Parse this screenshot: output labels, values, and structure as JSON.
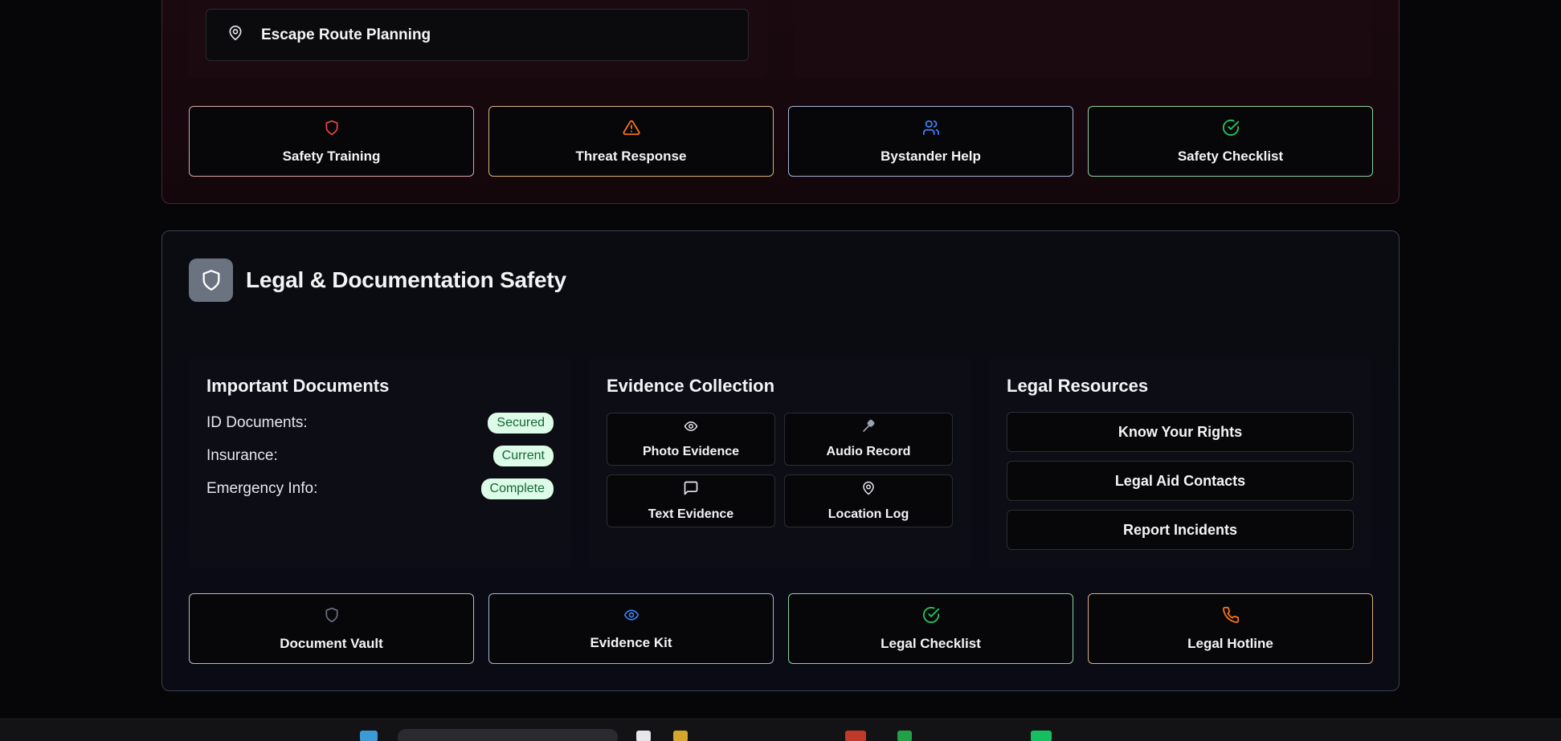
{
  "top_section": {
    "escape_label": "Escape Route Planning",
    "actions": [
      {
        "label": "Safety Training",
        "icon": "shield-icon",
        "color": "#ef4444"
      },
      {
        "label": "Threat Response",
        "icon": "warning-triangle-icon",
        "color": "#f97316"
      },
      {
        "label": "Bystander Help",
        "icon": "users-icon",
        "color": "#3b82f6"
      },
      {
        "label": "Safety Checklist",
        "icon": "check-circle-icon",
        "color": "#22c55e"
      }
    ]
  },
  "legal": {
    "title": "Legal & Documentation Safety",
    "icon": "shield-icon",
    "documents": {
      "title": "Important Documents",
      "rows": [
        {
          "label": "ID Documents:",
          "status": "Secured"
        },
        {
          "label": "Insurance:",
          "status": "Current"
        },
        {
          "label": "Emergency Info:",
          "status": "Complete"
        }
      ]
    },
    "evidence": {
      "title": "Evidence Collection",
      "items": [
        {
          "label": "Photo Evidence",
          "icon": "eye-icon"
        },
        {
          "label": "Audio Record",
          "icon": "microphone-icon"
        },
        {
          "label": "Text Evidence",
          "icon": "message-icon"
        },
        {
          "label": "Location Log",
          "icon": "map-pin-icon"
        }
      ]
    },
    "resources": {
      "title": "Legal Resources",
      "items": [
        "Know Your Rights",
        "Legal Aid Contacts",
        "Report Incidents"
      ]
    },
    "actions": [
      {
        "label": "Document Vault",
        "icon": "shield-icon",
        "color": "#6b7280"
      },
      {
        "label": "Evidence Kit",
        "icon": "eye-icon",
        "color": "#3b82f6"
      },
      {
        "label": "Legal Checklist",
        "icon": "check-circle-icon",
        "color": "#22c55e"
      },
      {
        "label": "Legal Hotline",
        "icon": "phone-icon",
        "color": "#f97316"
      }
    ]
  }
}
